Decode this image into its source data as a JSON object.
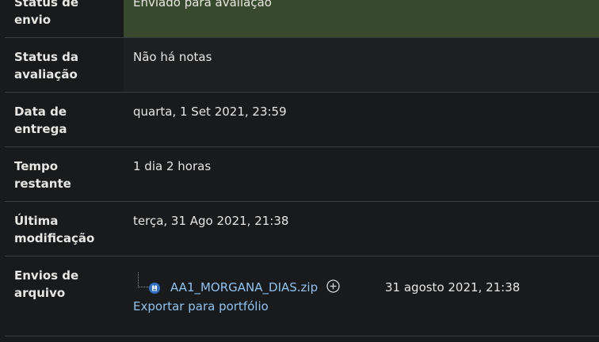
{
  "rows": {
    "status": {
      "label": "Status de envio",
      "value": "Enviado para avaliação"
    },
    "grading": {
      "label": "Status da avaliação",
      "value": "Não há notas"
    },
    "due": {
      "label": "Data de entrega",
      "value": "quarta, 1 Set 2021, 23:59"
    },
    "remaining": {
      "label": "Tempo restante",
      "value": "1 dia 2 horas"
    },
    "modified": {
      "label": "Última modificação",
      "value": "terça, 31 Ago 2021, 21:38"
    },
    "files": {
      "label": "Envios de arquivo",
      "filename": "AA1_MORGANA_DIAS.zip",
      "date": "31 agosto 2021, 21:38",
      "export_label": "Exportar para portfólio"
    }
  },
  "colors": {
    "status_bg": "#374a2d",
    "link": "#8fc3f2",
    "background": "#181a1b"
  },
  "icons": {
    "file": "zip-file-icon",
    "action": "plus-circle-icon"
  }
}
